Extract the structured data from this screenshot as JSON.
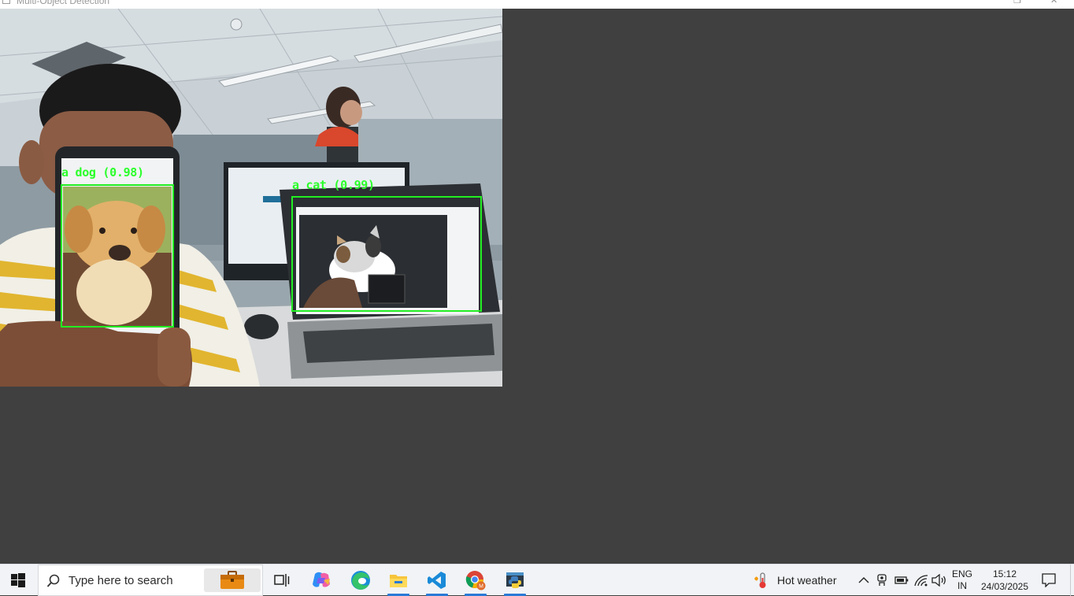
{
  "window": {
    "title": "Multi-Object Detection",
    "restore_glyph": "❐",
    "close_glyph": "✕"
  },
  "detections": [
    {
      "label": "a dog (0.98)",
      "box_color": "#22ee22"
    },
    {
      "label": "a cat (0.99)",
      "box_color": "#22ee22"
    }
  ],
  "taskbar": {
    "search_placeholder": "Type here to search",
    "apps": [
      "start-icon",
      "work-briefcase-icon",
      "task-view-icon",
      "copilot-icon",
      "edge-icon",
      "file-explorer-icon",
      "vscode-icon",
      "chrome-icon",
      "python-icon"
    ],
    "weather": {
      "text": "Hot weather",
      "icon": "thermometer-icon"
    },
    "tray_icons": [
      "chevron-up-icon",
      "meet-now-icon",
      "battery-icon",
      "wifi-icon",
      "volume-icon"
    ],
    "language": {
      "line1": "ENG",
      "line2": "IN"
    },
    "clock": {
      "time": "15:12",
      "date": "24/03/2025"
    },
    "notification_icon": "notification-icon",
    "accent_color": "#2a7ad5"
  }
}
